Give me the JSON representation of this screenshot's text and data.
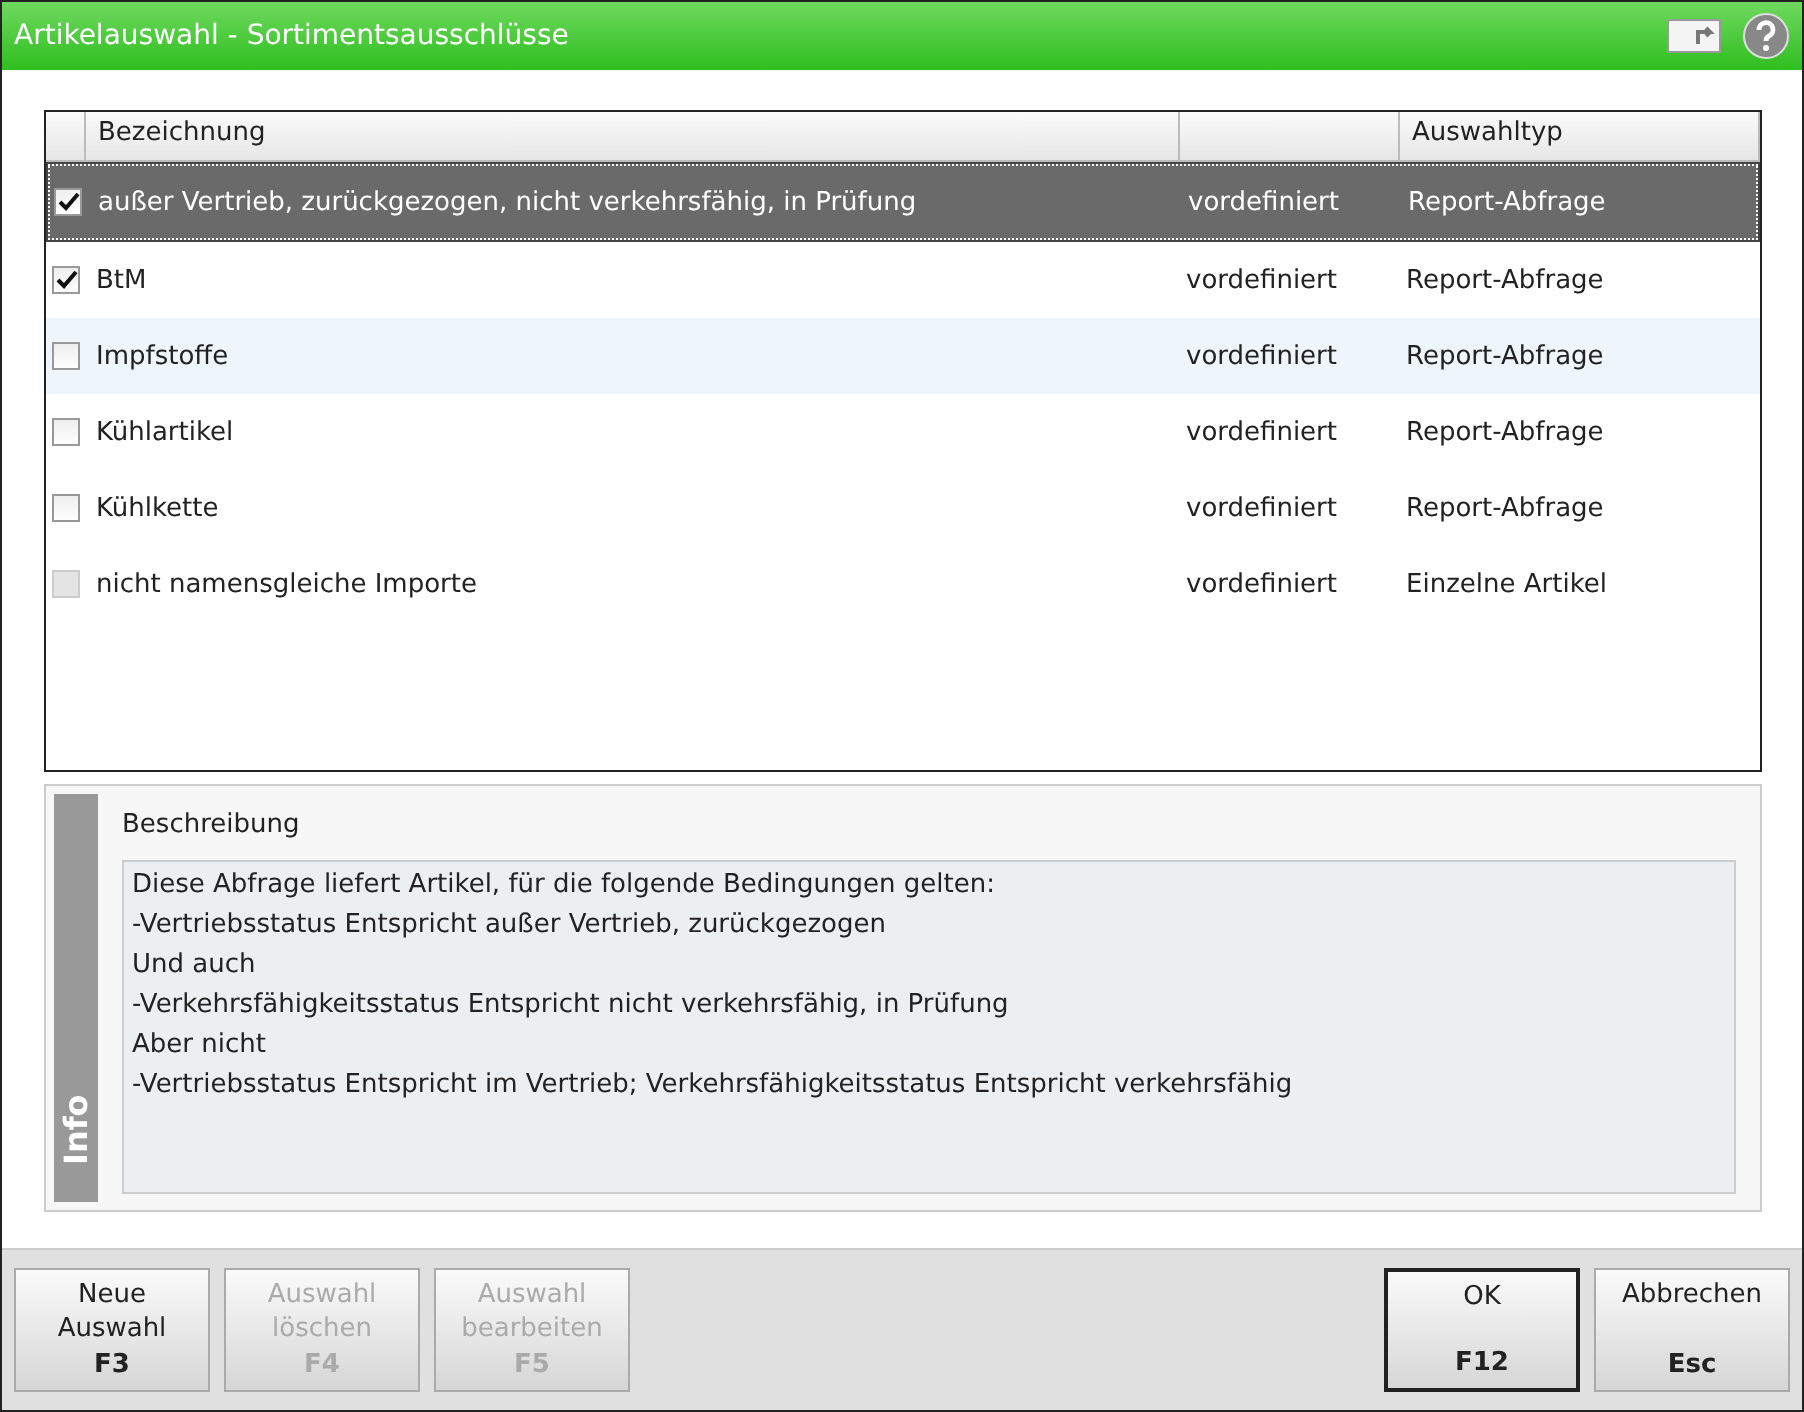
{
  "window": {
    "title": "Artikelauswahl - Sortimentsausschlüsse"
  },
  "table": {
    "columns": [
      "Bezeichnung",
      "Auswahltyp"
    ],
    "rows": [
      {
        "name": "außer Vertrieb, zurückgezogen, nicht verkehrsfähig, in Prüfung",
        "source": "vordefiniert",
        "type": "Report-Abfrage",
        "checked": true,
        "disabled": false,
        "selected": true,
        "hovered": false
      },
      {
        "name": "BtM",
        "source": "vordefiniert",
        "type": "Report-Abfrage",
        "checked": true,
        "disabled": false,
        "selected": false,
        "hovered": false
      },
      {
        "name": "Impfstoffe",
        "source": "vordefiniert",
        "type": "Report-Abfrage",
        "checked": false,
        "disabled": false,
        "selected": false,
        "hovered": true
      },
      {
        "name": "Kühlartikel",
        "source": "vordefiniert",
        "type": "Report-Abfrage",
        "checked": false,
        "disabled": false,
        "selected": false,
        "hovered": false
      },
      {
        "name": "Kühlkette",
        "source": "vordefiniert",
        "type": "Report-Abfrage",
        "checked": false,
        "disabled": false,
        "selected": false,
        "hovered": false
      },
      {
        "name": "nicht namensgleiche Importe",
        "source": "vordefiniert",
        "type": "Einzelne Artikel",
        "checked": false,
        "disabled": true,
        "selected": false,
        "hovered": false
      }
    ]
  },
  "info": {
    "tab": "Info",
    "heading": "Beschreibung",
    "lines": [
      "Diese Abfrage liefert Artikel, für die folgende Bedingungen gelten:",
      "-Vertriebsstatus Entspricht außer Vertrieb, zurückgezogen",
      "Und auch",
      "-Verkehrsfähigkeitsstatus Entspricht nicht verkehrsfähig, in Prüfung",
      "Aber nicht",
      "-Vertriebsstatus Entspricht im Vertrieb; Verkehrsfähigkeitsstatus Entspricht verkehrsfähig"
    ]
  },
  "buttons_left": [
    {
      "lines": [
        "Neue",
        "Auswahl"
      ],
      "key": "F3",
      "disabled": false,
      "default": false
    },
    {
      "lines": [
        "Auswahl",
        "löschen"
      ],
      "key": "F4",
      "disabled": true,
      "default": false
    },
    {
      "lines": [
        "Auswahl",
        "bearbeiten"
      ],
      "key": "F5",
      "disabled": true,
      "default": false
    }
  ],
  "buttons_right": [
    {
      "lines": [
        "OK"
      ],
      "key": "F12",
      "disabled": false,
      "default": true
    },
    {
      "lines": [
        "Abbrechen"
      ],
      "key": "Esc",
      "disabled": false,
      "default": false
    }
  ]
}
